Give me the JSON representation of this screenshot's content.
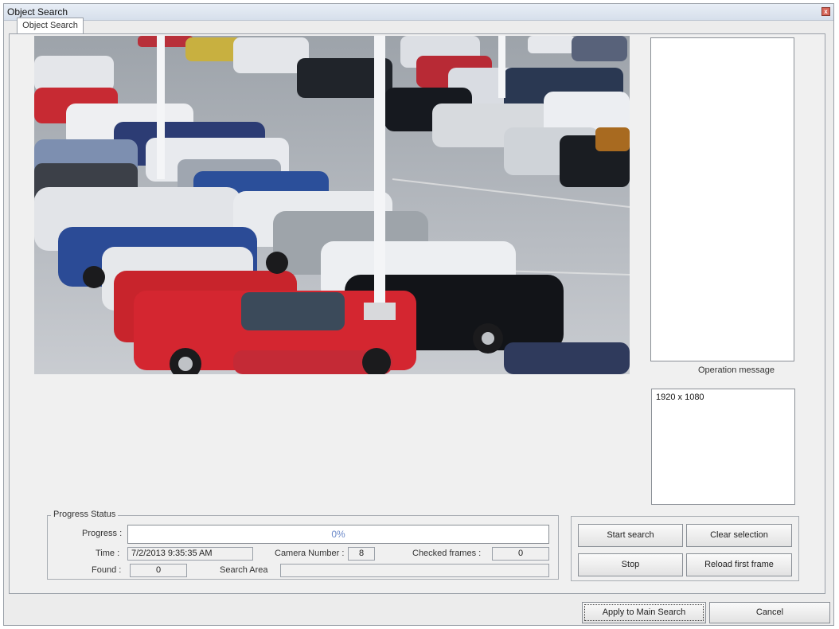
{
  "window": {
    "title": "Object Search"
  },
  "tabs": [
    {
      "label": "Object Search"
    }
  ],
  "operation": {
    "label": "Operation message",
    "message": ""
  },
  "info": {
    "resolution": "1920 x 1080"
  },
  "progress_status": {
    "legend": "Progress Status",
    "progress_label": "Progress :",
    "progress_value": "0%",
    "progress_fraction": 0,
    "time_label": "Time :",
    "time_value": "7/2/2013 9:35:35 AM",
    "camera_label": "Camera Number :",
    "camera_value": "8",
    "checked_label": "Checked frames :",
    "checked_value": "0",
    "found_label": "Found :",
    "found_value": "0",
    "area_label": "Search Area",
    "area_value": ""
  },
  "buttons": {
    "start_search": "Start search",
    "clear_selection": "Clear selection",
    "stop": "Stop",
    "reload_first_frame": "Reload first frame",
    "apply": "Apply to Main Search",
    "cancel": "Cancel"
  }
}
